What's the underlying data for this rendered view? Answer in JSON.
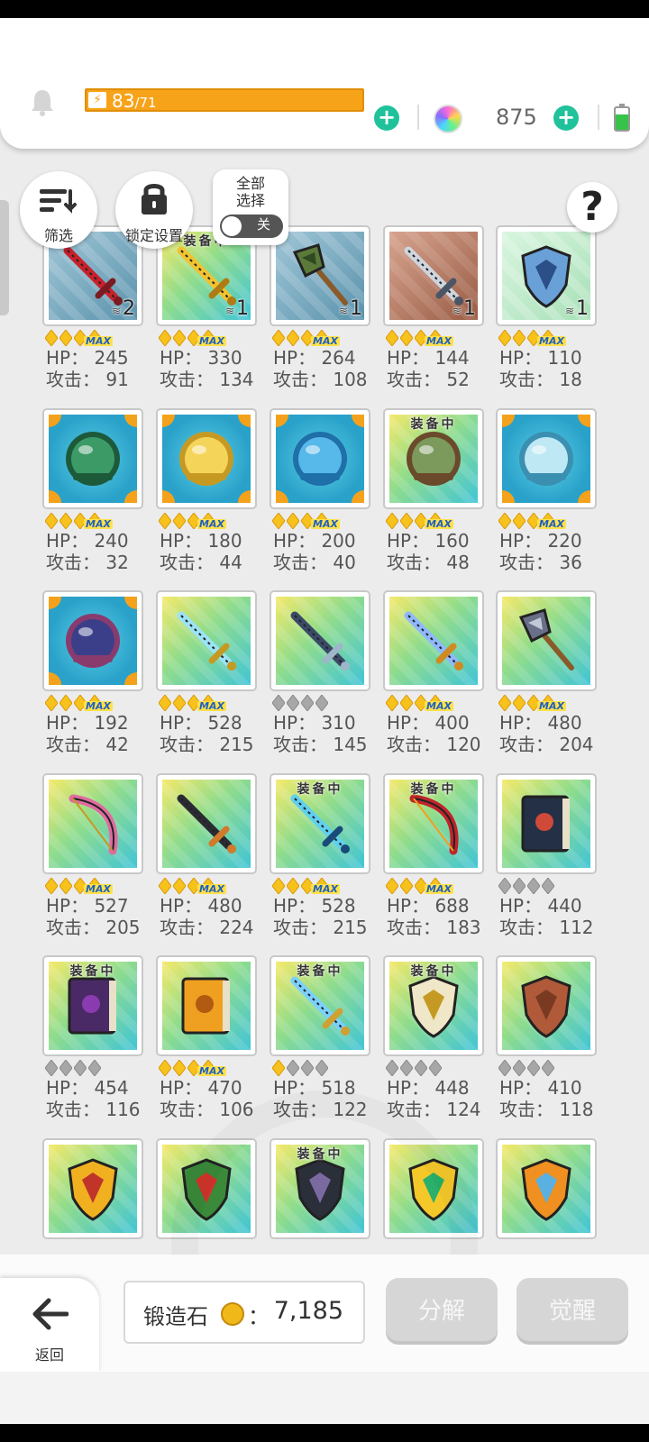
{
  "header": {
    "energy_current": "83",
    "energy_max": "/71",
    "energy_progress": 1.0,
    "gem_count": "875"
  },
  "toolbar": {
    "filter_label": "筛选",
    "lock_label": "锁定设置",
    "select_all_line1": "全部",
    "select_all_line2": "选择",
    "select_toggle_state": "关",
    "help_symbol": "?"
  },
  "labels": {
    "equipped": "装备中",
    "hp": "HP：",
    "attack": "攻击：",
    "max": "MAX"
  },
  "colors": {
    "energy_bar": "#f7a31a",
    "plus_button": "#1fc29a",
    "star_gold": "#f7c21c",
    "star_gray": "#a7a7a7",
    "button_disabled": "#d6d6d6"
  },
  "items": [
    {
      "icon": "red-spear",
      "bg": "steel",
      "count": "2",
      "equipped": false,
      "stars": "max",
      "hp": "245",
      "atk": "91"
    },
    {
      "icon": "golden-trident",
      "bg": "rainbow",
      "count": "1",
      "equipped": true,
      "stars": "max",
      "hp": "330",
      "atk": "134"
    },
    {
      "icon": "green-axe",
      "bg": "steel",
      "count": "1",
      "equipped": false,
      "stars": "max",
      "hp": "264",
      "atk": "108"
    },
    {
      "icon": "iron-sword",
      "bg": "rust",
      "count": "1",
      "equipped": false,
      "stars": "max",
      "hp": "144",
      "atk": "52"
    },
    {
      "icon": "blue-shield",
      "bg": "mint",
      "count": "1",
      "equipped": false,
      "stars": "max",
      "hp": "110",
      "atk": "18"
    },
    {
      "icon": "forest-orb",
      "bg": "orb",
      "count": "",
      "equipped": false,
      "stars": "max",
      "hp": "240",
      "atk": "32"
    },
    {
      "icon": "golden-orb",
      "bg": "orb",
      "count": "",
      "equipped": false,
      "stars": "max",
      "hp": "180",
      "atk": "44"
    },
    {
      "icon": "water-orb",
      "bg": "orb",
      "count": "",
      "equipped": false,
      "stars": "max",
      "hp": "200",
      "atk": "40"
    },
    {
      "icon": "earth-orb",
      "bg": "rainbow",
      "count": "",
      "equipped": true,
      "stars": "max",
      "hp": "160",
      "atk": "48"
    },
    {
      "icon": "crystal-orb",
      "bg": "orb",
      "count": "",
      "equipped": false,
      "stars": "max",
      "hp": "220",
      "atk": "36"
    },
    {
      "icon": "night-orb",
      "bg": "orb",
      "count": "",
      "equipped": false,
      "stars": "max",
      "hp": "192",
      "atk": "42"
    },
    {
      "icon": "crystal-sword",
      "bg": "rainbow",
      "count": "",
      "equipped": false,
      "stars": "max",
      "hp": "528",
      "atk": "215"
    },
    {
      "icon": "dark-lance",
      "bg": "rainbow",
      "count": "",
      "equipped": false,
      "stars": "gray4",
      "hp": "310",
      "atk": "145"
    },
    {
      "icon": "frost-blade",
      "bg": "rainbow",
      "count": "",
      "equipped": false,
      "stars": "max",
      "hp": "400",
      "atk": "120"
    },
    {
      "icon": "war-axe",
      "bg": "rainbow",
      "count": "",
      "equipped": false,
      "stars": "max",
      "hp": "480",
      "atk": "204"
    },
    {
      "icon": "pink-scythe",
      "bg": "rainbow",
      "count": "",
      "equipped": false,
      "stars": "max",
      "hp": "527",
      "atk": "205"
    },
    {
      "icon": "black-staff",
      "bg": "rainbow",
      "count": "",
      "equipped": false,
      "stars": "max",
      "hp": "480",
      "atk": "224"
    },
    {
      "icon": "ice-trident",
      "bg": "rainbow",
      "count": "",
      "equipped": true,
      "stars": "max",
      "hp": "528",
      "atk": "215"
    },
    {
      "icon": "flame-bow",
      "bg": "rainbow",
      "count": "",
      "equipped": true,
      "stars": "max",
      "hp": "688",
      "atk": "183"
    },
    {
      "icon": "dark-tome",
      "bg": "rainbow",
      "count": "",
      "equipped": false,
      "stars": "gray4",
      "hp": "440",
      "atk": "112"
    },
    {
      "icon": "purple-tome",
      "bg": "rainbow",
      "count": "",
      "equipped": true,
      "stars": "gray4",
      "hp": "454",
      "atk": "116"
    },
    {
      "icon": "sun-tome",
      "bg": "rainbow",
      "count": "",
      "equipped": false,
      "stars": "max",
      "hp": "470",
      "atk": "106"
    },
    {
      "icon": "crystal-scepter",
      "bg": "rainbow",
      "count": "",
      "equipped": true,
      "stars": "gold1",
      "hp": "518",
      "atk": "122"
    },
    {
      "icon": "rune-shield",
      "bg": "rainbow",
      "count": "",
      "equipped": true,
      "stars": "gray4",
      "hp": "448",
      "atk": "124"
    },
    {
      "icon": "bronze-gauntlet",
      "bg": "rainbow",
      "count": "",
      "equipped": false,
      "stars": "gray4",
      "hp": "410",
      "atk": "118"
    },
    {
      "icon": "winged-badge",
      "bg": "rainbow",
      "count": "",
      "equipped": false,
      "stars": "none",
      "hp": "",
      "atk": ""
    },
    {
      "icon": "holly-wreath",
      "bg": "rainbow",
      "count": "",
      "equipped": false,
      "stars": "none",
      "hp": "",
      "atk": ""
    },
    {
      "icon": "dark-shield",
      "bg": "rainbow",
      "count": "",
      "equipped": true,
      "stars": "none",
      "hp": "",
      "atk": ""
    },
    {
      "icon": "golden-emblem",
      "bg": "rainbow",
      "count": "",
      "equipped": false,
      "stars": "none",
      "hp": "",
      "atk": ""
    },
    {
      "icon": "thunder-crown",
      "bg": "rainbow",
      "count": "",
      "equipped": false,
      "stars": "none",
      "hp": "",
      "atk": ""
    }
  ],
  "footer": {
    "back_label": "返回",
    "forge_stone_label": "锻造石",
    "forge_stone_colon": "：",
    "forge_stone_value": "7,185",
    "decompose_label": "分解",
    "awaken_label": "觉醒"
  }
}
